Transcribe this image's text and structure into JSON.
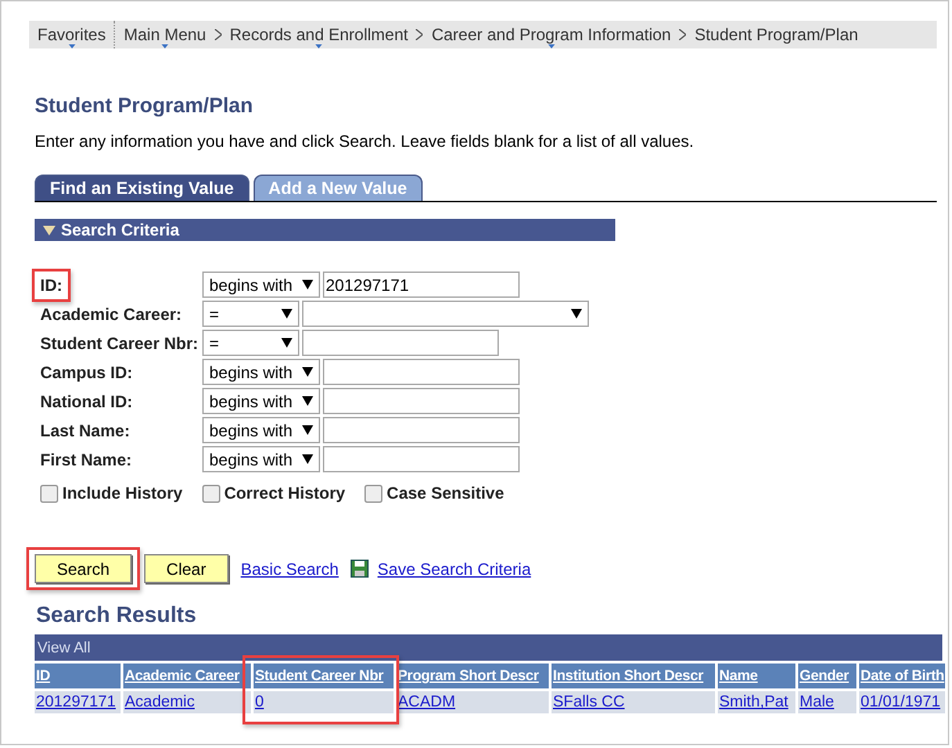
{
  "breadcrumb": [
    {
      "label": "Favorites",
      "has_menu": true
    },
    {
      "label": "Main Menu",
      "has_menu": true
    },
    {
      "label": "Records and Enrollment",
      "has_menu": true
    },
    {
      "label": "Career and Program Information",
      "has_menu": true
    },
    {
      "label": "Student Program/Plan",
      "has_menu": false
    }
  ],
  "page_title": "Student Program/Plan",
  "instructions": "Enter any information you have and click Search. Leave fields blank for a list of all values.",
  "tabs": [
    {
      "label": "Find an Existing Value",
      "selected": true
    },
    {
      "label": "Add a New Value",
      "selected": false
    }
  ],
  "section": {
    "title": "Search Criteria",
    "expanded": true
  },
  "fields": [
    {
      "label": "ID:",
      "operator": "begins with",
      "value": "201297171",
      "kind": "text",
      "highlighted": true
    },
    {
      "label": "Academic Career:",
      "operator": "=",
      "kind": "select",
      "highlighted": false
    },
    {
      "label": "Student Career Nbr:",
      "operator": "=",
      "kind": "text",
      "highlighted": false
    },
    {
      "label": "Campus ID:",
      "operator": "begins with",
      "kind": "text",
      "highlighted": false
    },
    {
      "label": "National ID:",
      "operator": "begins with",
      "kind": "text",
      "highlighted": false
    },
    {
      "label": "Last Name:",
      "operator": "begins with",
      "kind": "text",
      "highlighted": false
    },
    {
      "label": "First Name:",
      "operator": "begins with",
      "kind": "text",
      "highlighted": false
    }
  ],
  "options": [
    {
      "label": "Include History",
      "checked": false
    },
    {
      "label": "Correct History",
      "checked": false
    },
    {
      "label": "Case Sensitive",
      "checked": false
    }
  ],
  "buttons": [
    {
      "label": "Search",
      "highlighted": true
    },
    {
      "label": "Clear",
      "highlighted": false
    }
  ],
  "links": [
    {
      "label": "Basic Search",
      "kind": "link"
    },
    {
      "label": "Save Search Criteria",
      "kind": "save"
    }
  ],
  "results": {
    "title": "Search Results",
    "view_all": "View All",
    "columns": [
      {
        "label": "ID",
        "highlighted": false
      },
      {
        "label": "Academic Career",
        "highlighted": false
      },
      {
        "label": "Student Career Nbr",
        "highlighted": true
      },
      {
        "label": "Program Short Descr",
        "highlighted": false
      },
      {
        "label": "Institution Short Descr",
        "highlighted": false
      },
      {
        "label": "Name",
        "highlighted": false
      },
      {
        "label": "Gender",
        "highlighted": false
      },
      {
        "label": "Date of Birth",
        "highlighted": false
      }
    ],
    "rows": [
      [
        "201297171",
        "Academic",
        "0",
        "ACADM",
        "SFalls CC",
        "Smith,Pat",
        "Male",
        "01/01/1971"
      ]
    ]
  }
}
